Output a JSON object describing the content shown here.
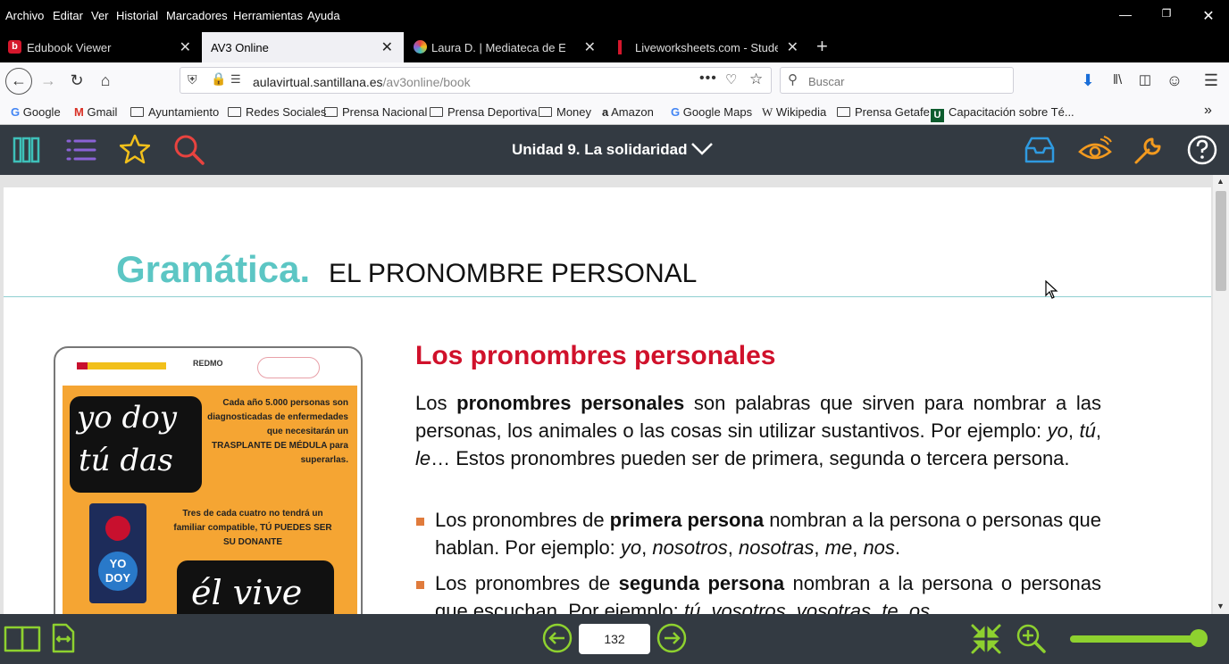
{
  "menu": [
    "Archivo",
    "Editar",
    "Ver",
    "Historial",
    "Marcadores",
    "Herramientas",
    "Ayuda"
  ],
  "tabs": [
    {
      "title": "Edubook Viewer",
      "active": false
    },
    {
      "title": "AV3 Online",
      "active": true
    },
    {
      "title": "Laura D. | Mediateca de Educa",
      "active": false
    },
    {
      "title": "Liveworksheets.com - Student",
      "active": false
    }
  ],
  "address": {
    "host": "aulavirtual.santillana.es",
    "path": "/av3online/book"
  },
  "search": {
    "placeholder": "Buscar"
  },
  "bookmarks": [
    "Google",
    "Gmail",
    "Ayuntamiento",
    "Redes Sociales",
    "Prensa Nacional",
    "Prensa Deportiva",
    "Money",
    "Amazon",
    "Google Maps",
    "Wikipedia",
    "Prensa Getafe",
    "Capacitación sobre Té..."
  ],
  "app": {
    "unit_title": "Unidad 9. La solidaridad"
  },
  "page": {
    "header_accent": "Gramática.",
    "header_title": "EL PRONOMBRE PERSONAL",
    "section_title": "Los pronombres personales",
    "para1_start": "Los ",
    "para1_bold": "pronombres personales",
    "para1_end": " son palabras que sirven para nombrar a las personas, los animales o las cosas sin utilizar sustantivos. Por ejemplo:",
    "para1_it1": "yo",
    "para1_it2": "tú",
    "para1_it3": "le",
    "para1_tail": "… Estos pronombres pueden ser de primera, segunda o tercera persona.",
    "b1_start": "Los pronombres de ",
    "b1_bold": "primera persona",
    "b1_end": " nombran a la persona o personas que hablan. Por ejemplo: ",
    "b1_examples": [
      "yo",
      "nosotros",
      "nosotras",
      "me",
      "nos"
    ],
    "b2_start": "Los pronombres de ",
    "b2_bold": "segunda persona",
    "b2_end": " nombran a la persona o personas que escuchan. Por ejemplo: ",
    "b2_examples": [
      "tú",
      "vosotros",
      "vosotras",
      "te",
      "os"
    ],
    "poster": {
      "logo_text": "REDMO",
      "handwriting1": "yo doy",
      "handwriting2": "tú das",
      "handwriting3": "él vive",
      "info1": "Cada año 5.000 personas son diagnosticadas de enfermedades que necesitarán un TRASPLANTE DE MÉDULA para superarlas.",
      "info2": "Tres de cada cuatro no tendrá un familiar compatible, TÚ PUEDES SER SU DONANTE",
      "badge1": "YO",
      "badge2": "DOY"
    }
  },
  "bottom": {
    "page_number": "132",
    "zoom_level": 1.0
  },
  "colors": {
    "accent_teal": "#5cc6c4",
    "heading_red": "#d0112b",
    "app_bar": "#333a42",
    "icon_teal": "#3ec0b9",
    "icon_purple": "#8b62d6",
    "icon_yellow": "#f2c01b",
    "icon_red": "#e8433f",
    "icon_orange": "#f39a1f",
    "icon_green": "#8ed12f"
  }
}
